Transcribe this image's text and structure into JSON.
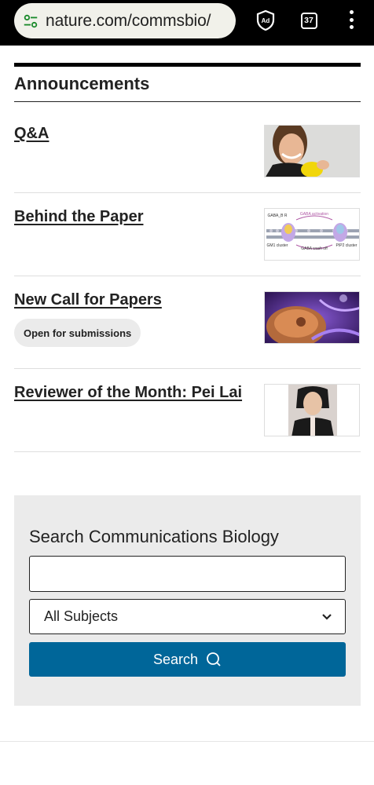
{
  "browser": {
    "url": "nature.com/commsbio/",
    "tab_count": "37",
    "adblock_label": "Ad"
  },
  "announcements": {
    "heading": "Announcements",
    "items": [
      {
        "title": "Q&A",
        "image_alt": "portrait-smiling-person-with-yellow-object"
      },
      {
        "title": "Behind the Paper",
        "image_alt": "membrane-receptor-diagram",
        "diagram_labels": [
          "GABA activation",
          "GABA wash off",
          "GM1 cluster",
          "PIP2 cluster",
          "GABA_B R"
        ]
      },
      {
        "title": "New Call for Papers",
        "badge": "Open for submissions",
        "image_alt": "purple-cell-illustration"
      },
      {
        "title": "Reviewer of the Month: Pei Lai",
        "image_alt": "portrait-pei-lai"
      }
    ]
  },
  "search": {
    "title": "Search Communications Biology",
    "input_value": "",
    "subject_selected": "All Subjects",
    "button_label": "Search"
  },
  "colors": {
    "accent": "#006699",
    "panel_bg": "#ebebeb",
    "browser_bar": "#000000"
  }
}
